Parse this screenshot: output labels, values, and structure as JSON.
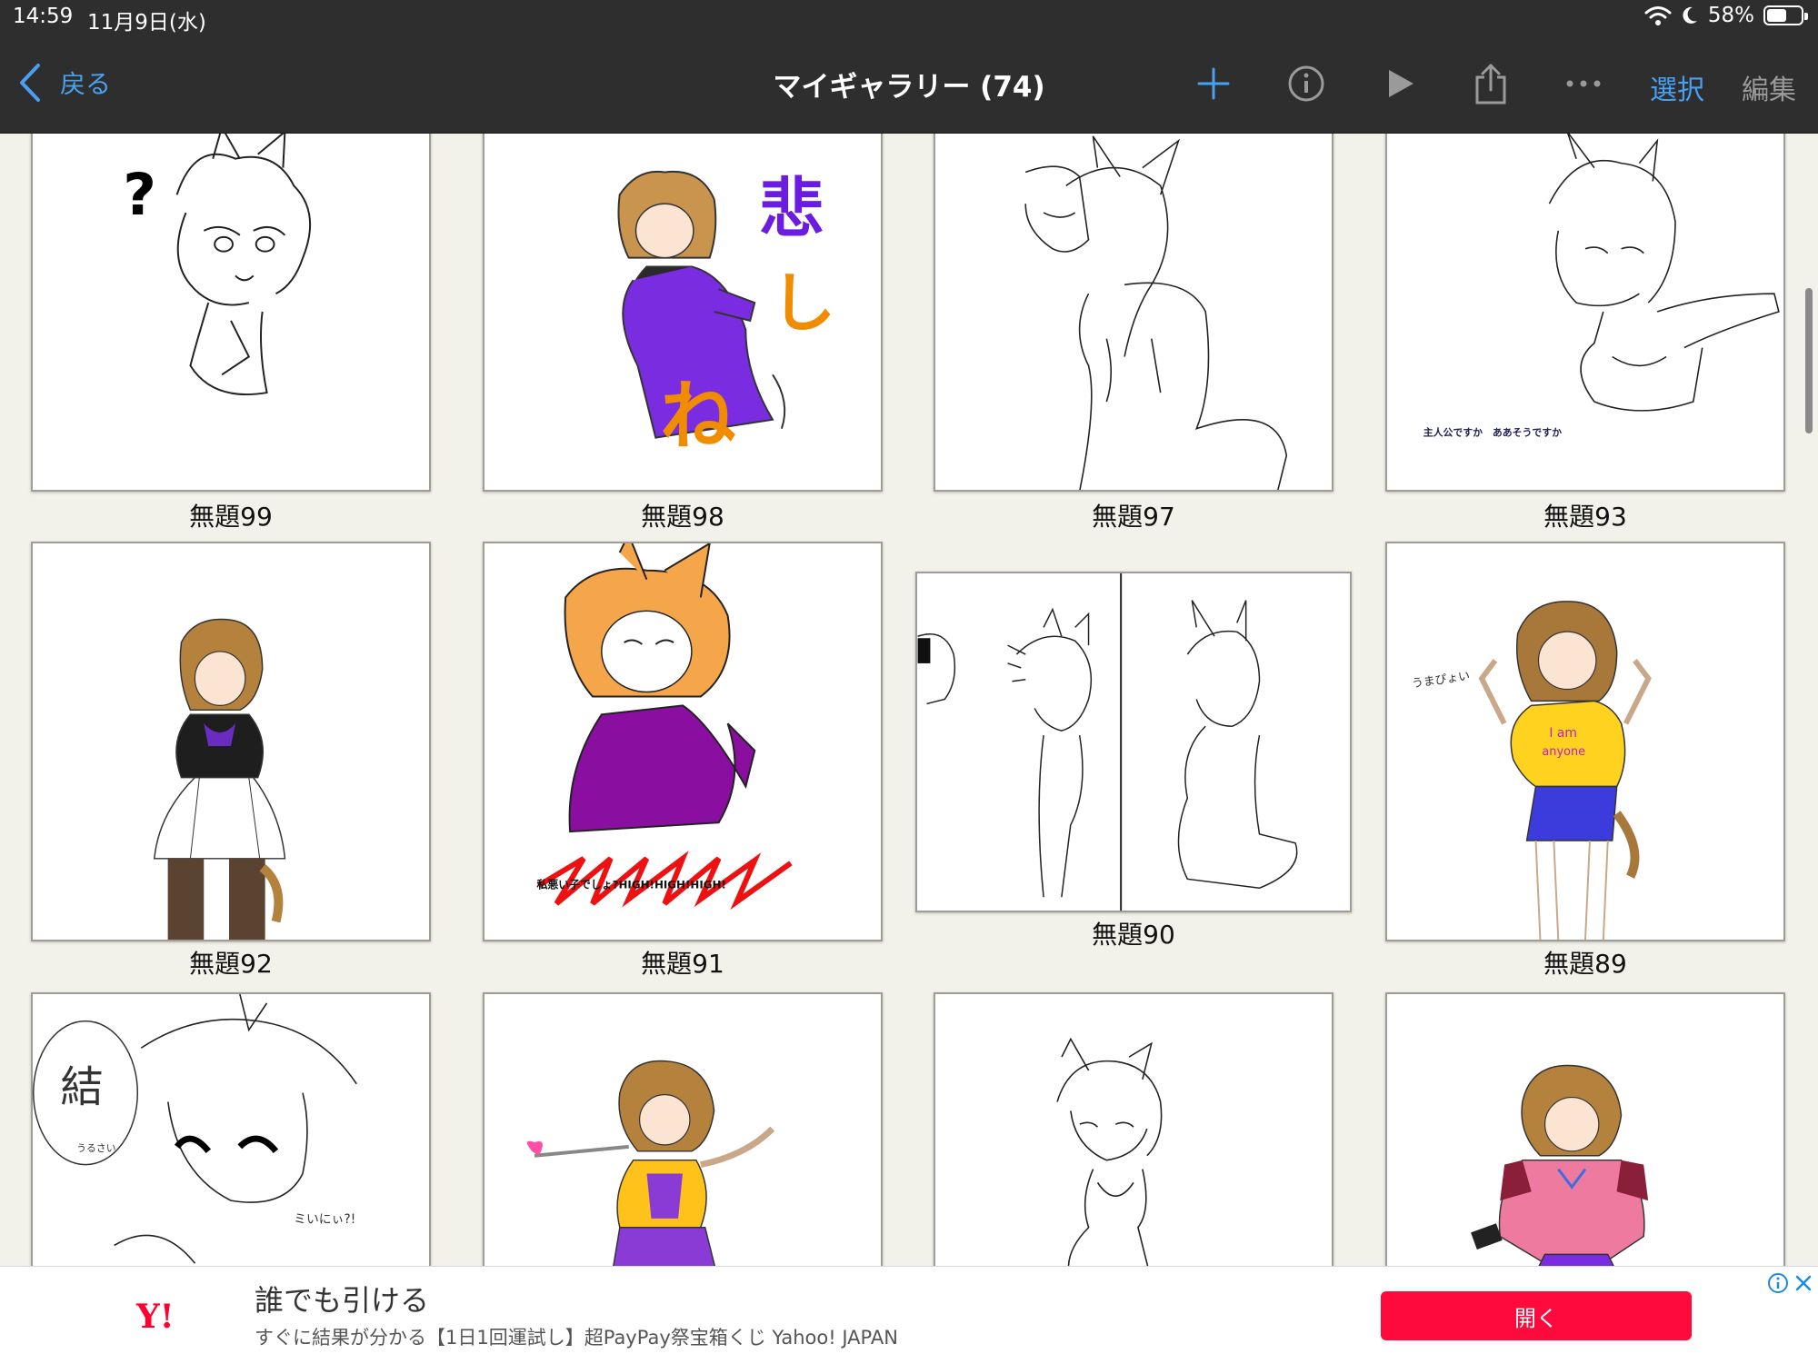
{
  "status_bar": {
    "time": "14:59",
    "date": "11月9日(水)",
    "battery": "58%",
    "battery_level": 0.58
  },
  "nav": {
    "back_label": "戻る",
    "title": "マイギャラリー (74)",
    "select_label": "選択",
    "edit_label": "編集",
    "accent_color": "#4aa0f0"
  },
  "gallery": {
    "items": [
      {
        "title": "無題99"
      },
      {
        "title": "無題98"
      },
      {
        "title": "無題97"
      },
      {
        "title": "無題93"
      },
      {
        "title": "無題92"
      },
      {
        "title": "無題91"
      },
      {
        "title": "無題90"
      },
      {
        "title": "無題89"
      },
      {
        "title": ""
      },
      {
        "title": ""
      },
      {
        "title": ""
      },
      {
        "title": ""
      }
    ],
    "drawing_text": {
      "t99": "?",
      "t98_a": "悲",
      "t98_b": "し",
      "t98_c": "ね",
      "t93": "主人公ですか　ああそうですか",
      "t91": "私悪い子でしょ?HIGH!HIGH!HIGH!",
      "t89_a": "うまぴょい",
      "t89_b": "I am",
      "t89_c": "anyone",
      "t_r3a": "結",
      "t_r3a2": "うるさい",
      "t_r3a3": "ミいにぃ?!"
    }
  },
  "ad": {
    "logo": "Y!",
    "title": "誰でも引ける",
    "subtitle": "すぐに結果が分かる【1日1回運試し】超PayPay祭宝箱くじ Yahoo! JAPAN",
    "button_label": "開く",
    "button_color": "#ff0a3c"
  }
}
